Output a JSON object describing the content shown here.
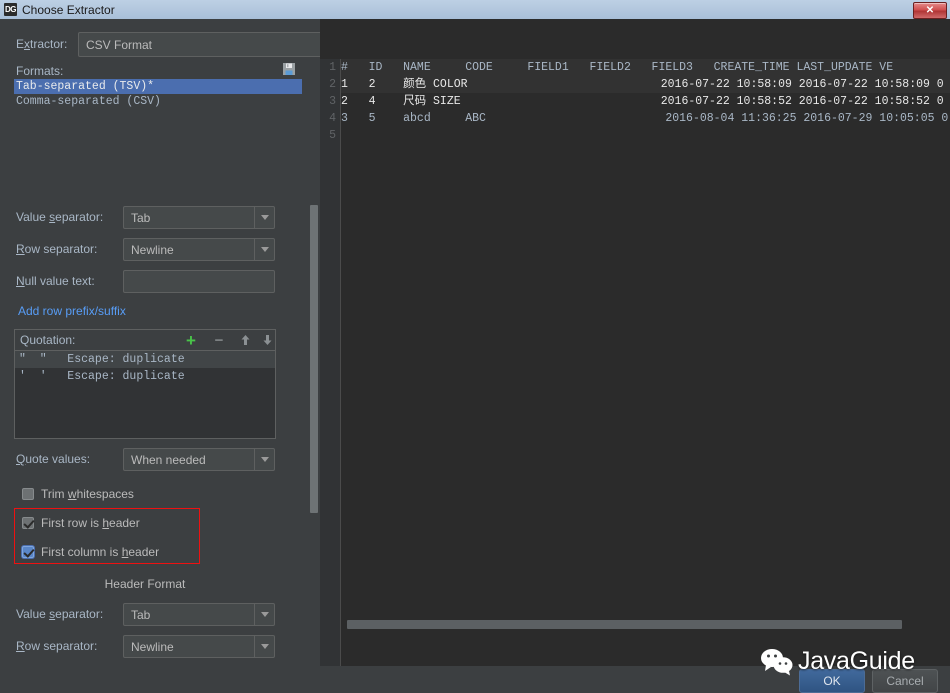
{
  "window": {
    "title": "Choose Extractor",
    "icon_label": "DG",
    "close_label": "✕"
  },
  "extractor": {
    "label_prefix": "E",
    "label_mnemonic": "x",
    "label_suffix": "tractor:",
    "value": "CSV Format"
  },
  "formats": {
    "label": "Formats:",
    "save_icon": "save-icon",
    "items": [
      {
        "label": "Tab-separated (TSV)*",
        "selected": true
      },
      {
        "label": "Comma-separated (CSV)",
        "selected": false
      }
    ]
  },
  "value_separator": {
    "label_prefix": "Value ",
    "label_mnemonic": "s",
    "label_suffix": "eparator:",
    "value": "Tab"
  },
  "row_separator": {
    "label_prefix": "",
    "label_mnemonic": "R",
    "label_suffix": "ow separator:",
    "value": "Newline"
  },
  "null_value": {
    "label_prefix": "",
    "label_mnemonic": "N",
    "label_suffix": "ull value text:",
    "value": ""
  },
  "add_prefix_link": "Add row prefix/suffix",
  "quotation": {
    "label": "Quotation:",
    "buttons": [
      "add-icon",
      "remove-icon",
      "move-up-icon",
      "move-down-icon"
    ],
    "rows": [
      {
        "text": "\"  \"   Escape: duplicate",
        "selected": true
      },
      {
        "text": "'  '   Escape: duplicate",
        "selected": false
      }
    ]
  },
  "quote_values": {
    "label_prefix": "",
    "label_mnemonic": "Q",
    "label_suffix": "uote values:",
    "value": "When needed"
  },
  "checkboxes": [
    {
      "label_prefix": "Trim ",
      "mnemonic": "w",
      "label_suffix": "hitespaces",
      "checked": false,
      "focused": false
    },
    {
      "label_prefix": "First row is ",
      "mnemonic": "h",
      "label_suffix": "eader",
      "checked": true,
      "focused": false
    },
    {
      "label_prefix": "First column is ",
      "mnemonic": "h",
      "label_suffix": "eader",
      "checked": true,
      "focused": true
    }
  ],
  "header_format": {
    "title": "Header Format",
    "value_separator": {
      "label_prefix": "Value ",
      "label_mnemonic": "s",
      "label_suffix": "eparator:",
      "value": "Tab"
    },
    "row_separator": {
      "label_prefix": "",
      "label_mnemonic": "R",
      "label_suffix": "ow separator:",
      "value": "Newline"
    }
  },
  "preview": {
    "line_numbers": [
      "1",
      "2",
      "3",
      "4",
      "5"
    ],
    "rows": [
      {
        "text": "#   ID   NAME     CODE     FIELD1   FIELD2   FIELD3   CREATE_TIME LAST_UPDATE VE",
        "header": true,
        "cjk": false
      },
      {
        "text": "1   2    颜色 COLOR                            2016-07-22 10:58:09 2016-07-22 10:58:09 0",
        "header": false,
        "cjk": true
      },
      {
        "text": "2   4    尺码 SIZE                             2016-07-22 10:58:52 2016-07-22 10:58:52 0",
        "header": false,
        "cjk": true
      },
      {
        "text": "3   5    abcd     ABC                          2016-08-04 11:36:25 2016-07-29 10:05:05 0",
        "header": false,
        "cjk": false
      },
      {
        "text": "",
        "header": false,
        "cjk": false
      }
    ]
  },
  "buttons": {
    "ok": "OK",
    "cancel": "Cancel"
  },
  "watermark": {
    "text": "JavaGuide",
    "icon": "wechat-icon"
  },
  "colors": {
    "accent_selection": "#4b6eaf",
    "link": "#589df6",
    "annotation": "#ee1111",
    "add_button": "#49c449"
  }
}
